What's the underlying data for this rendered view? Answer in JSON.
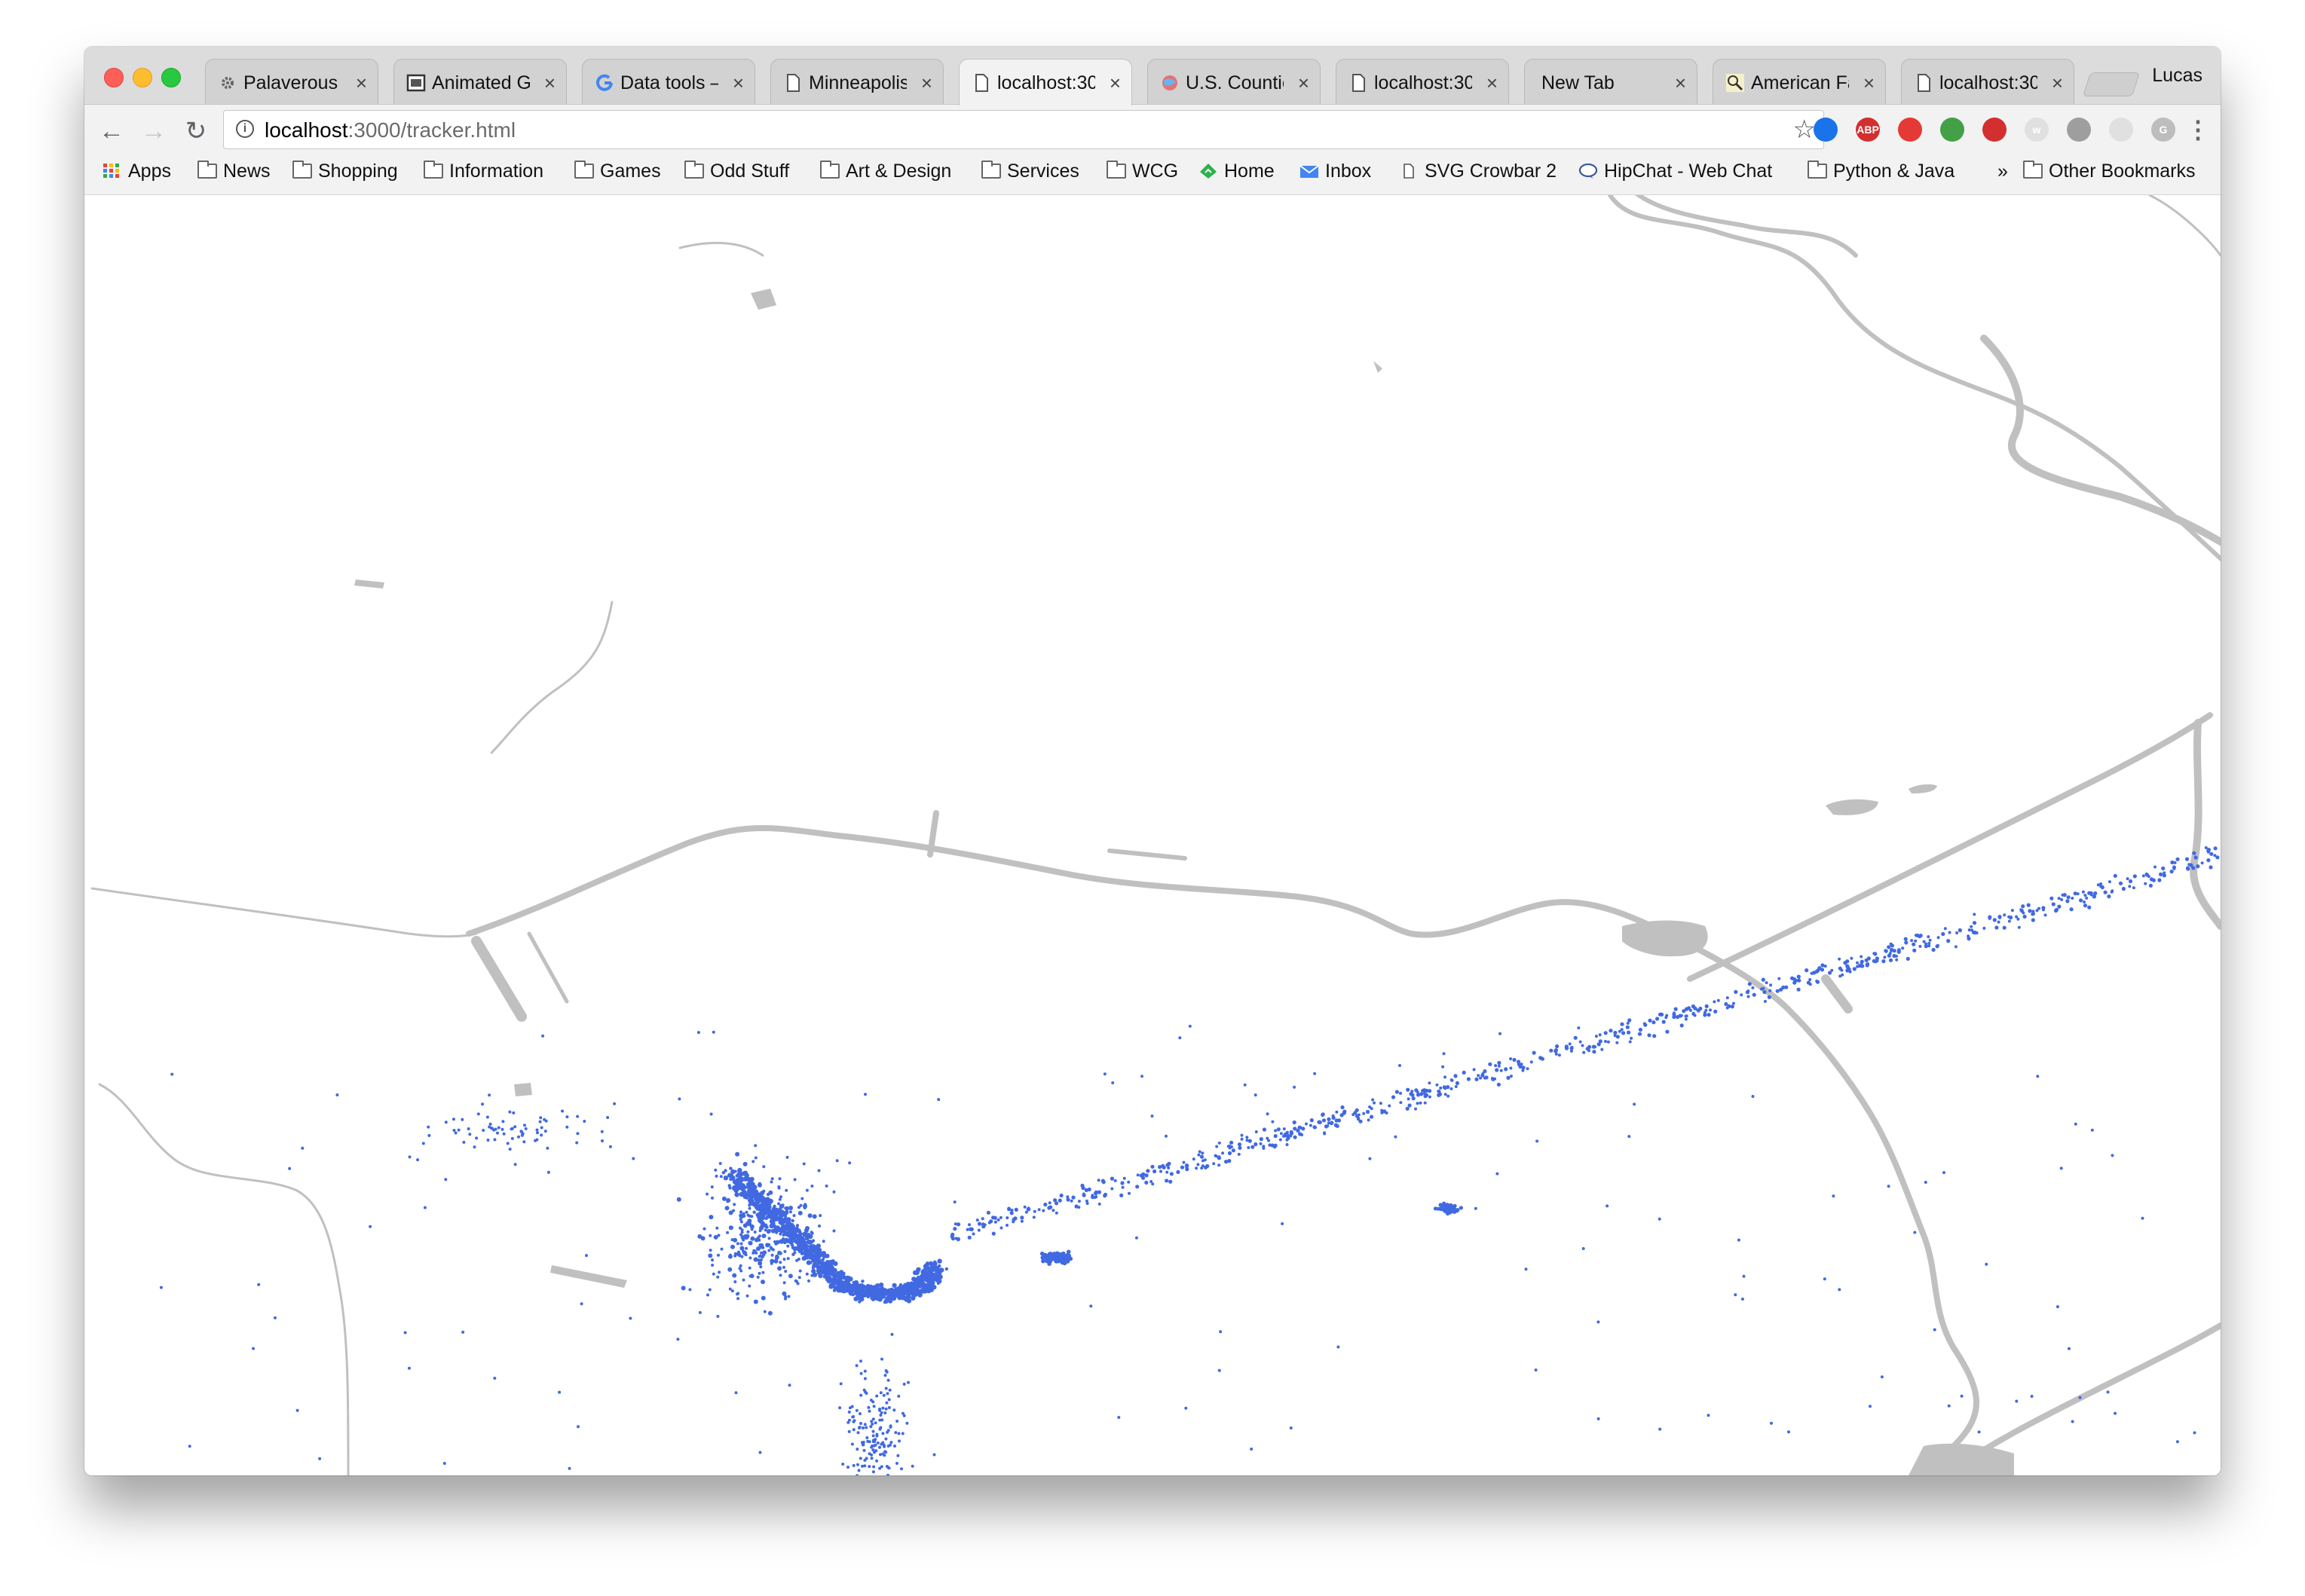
{
  "window": {
    "profile_name": "Lucas",
    "tabs": [
      {
        "title": "Palaverous",
        "icon": "gear-icon",
        "active": false
      },
      {
        "title": "Animated GI",
        "icon": "image-icon",
        "active": false
      },
      {
        "title": "Data tools –",
        "icon": "google-icon",
        "active": false
      },
      {
        "title": "Minneapolis",
        "icon": "document-icon",
        "active": false
      },
      {
        "title": "localhost:30",
        "icon": "document-icon",
        "active": true
      },
      {
        "title": "U.S. Countie",
        "icon": "globe-icon",
        "active": false
      },
      {
        "title": "localhost:30",
        "icon": "document-icon",
        "active": false
      },
      {
        "title": "New Tab",
        "icon": "",
        "active": false
      },
      {
        "title": "American Fa",
        "icon": "magnifier-icon",
        "active": false
      },
      {
        "title": "localhost:30",
        "icon": "document-icon",
        "active": false
      }
    ]
  },
  "toolbar": {
    "url_host": "localhost",
    "url_rest": ":3000/tracker.html",
    "extensions": [
      {
        "name": "circle-extension-icon",
        "label": "",
        "color": "#1a73e8"
      },
      {
        "name": "adblock-extension-icon",
        "label": "ABP",
        "color": "#d32f2f"
      },
      {
        "name": "hand-extension-icon",
        "label": "",
        "color": "#e53935"
      },
      {
        "name": "leaf-extension-icon",
        "label": "",
        "color": "#43a047"
      },
      {
        "name": "forward-extension-icon",
        "label": "",
        "color": "#d32f2f"
      },
      {
        "name": "w-extension-icon",
        "label": "w",
        "color": "#e0e0e0"
      },
      {
        "name": "square-extension-icon",
        "label": "",
        "color": "#9e9e9e"
      },
      {
        "name": "moon-extension-icon",
        "label": "",
        "color": "#e0e0e0"
      },
      {
        "name": "g-extension-icon",
        "label": "G",
        "color": "#bdbdbd"
      }
    ]
  },
  "bookmarks": {
    "items": [
      {
        "label": "Apps",
        "icon": "apps-grid-icon"
      },
      {
        "label": "News",
        "icon": "folder-icon"
      },
      {
        "label": "Shopping",
        "icon": "folder-icon"
      },
      {
        "label": "Information",
        "icon": "folder-icon"
      },
      {
        "label": "Games",
        "icon": "folder-icon"
      },
      {
        "label": "Odd Stuff",
        "icon": "folder-icon"
      },
      {
        "label": "Art & Design",
        "icon": "folder-icon"
      },
      {
        "label": "Services",
        "icon": "folder-icon"
      },
      {
        "label": "WCG",
        "icon": "folder-icon"
      },
      {
        "label": "Home",
        "icon": "feedly-icon"
      },
      {
        "label": "Inbox",
        "icon": "inbox-icon"
      },
      {
        "label": "SVG Crowbar 2",
        "icon": "document-icon"
      },
      {
        "label": "HipChat - Web Chat",
        "icon": "chat-icon"
      },
      {
        "label": "Python & Java",
        "icon": "folder-icon"
      }
    ],
    "overflow_label": "»",
    "other_label": "Other Bookmarks"
  },
  "map": {
    "road_color": "#c0c0c0",
    "point_color": "#4169e1"
  }
}
